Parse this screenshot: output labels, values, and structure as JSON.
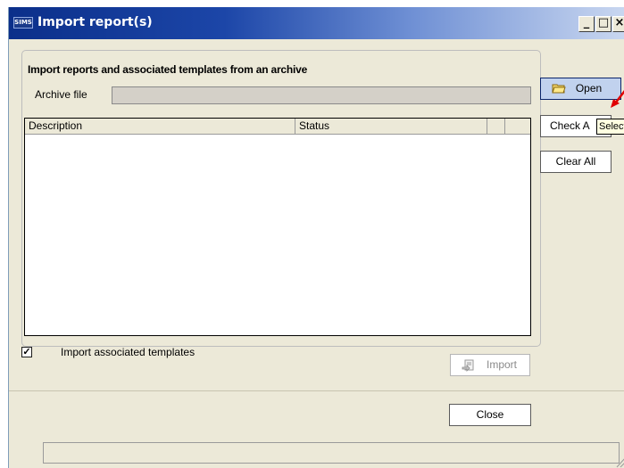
{
  "window": {
    "app_icon_text": "SIMS",
    "title": "Import report(s)",
    "minimize_glyph": "_",
    "maximize_glyph": "□",
    "close_glyph": "×"
  },
  "group": {
    "caption": "Import reports and associated templates from an archive",
    "archive_label": "Archive file",
    "archive_value": ""
  },
  "list": {
    "columns": [
      "Description",
      "Status",
      ""
    ],
    "rows": []
  },
  "buttons": {
    "open_label": "Open",
    "check_all_label": "Check A",
    "clear_all_label": "Clear All",
    "import_label": "Import",
    "close_label": "Close"
  },
  "tooltip": {
    "text": "Select"
  },
  "options": {
    "import_templates_label": "Import associated templates",
    "import_templates_checked": true
  },
  "colors": {
    "title_gradient_start": "#0b2f8a",
    "dialog_bg": "#ece9d8",
    "open_button_bg": "#c1d2ee",
    "annotation_arrow": "#e00000"
  },
  "icons": {
    "open": "open-folder-icon",
    "import": "import-icon",
    "grip": "resize-grip-icon"
  }
}
